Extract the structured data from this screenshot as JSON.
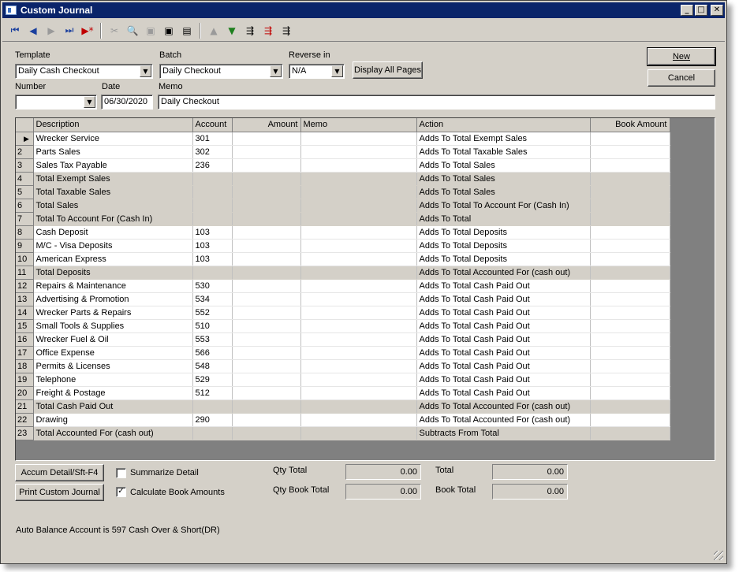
{
  "window": {
    "title": "Custom Journal",
    "min": "_",
    "max": "□",
    "close": "✕"
  },
  "toolbar": {
    "first": "⏮",
    "prev": "◀",
    "next": "▶",
    "last": "⏭",
    "new": "▶*",
    "cut": "✂",
    "find": "🔍",
    "save": "▣",
    "savenew": "▣",
    "props": "▤",
    "up": "▲",
    "down": "▼",
    "ins1": "⇶",
    "ins2": "⇶",
    "ins3": "⇶"
  },
  "form": {
    "template_label": "Template",
    "template_value": "Daily Cash Checkout",
    "batch_label": "Batch",
    "batch_value": "Daily Checkout",
    "reverse_label": "Reverse in",
    "reverse_value": "N/A",
    "display_all": "Display All Pages",
    "number_label": "Number",
    "number_value": "",
    "date_label": "Date",
    "date_value": "06/30/2020",
    "memo_label": "Memo",
    "memo_value": "Daily Checkout",
    "new_btn": "New",
    "cancel_btn": "Cancel"
  },
  "grid": {
    "headers": [
      "Description",
      "Account",
      "Amount",
      "Memo",
      "Action",
      "Book Amount"
    ],
    "rows": [
      {
        "n": "",
        "desc": "Wrecker Service",
        "acct": "301",
        "action": "Adds To Total Exempt Sales",
        "total": false
      },
      {
        "n": "2",
        "desc": "Parts Sales",
        "acct": "302",
        "action": "Adds To Total Taxable Sales",
        "total": false
      },
      {
        "n": "3",
        "desc": "Sales Tax Payable",
        "acct": "236",
        "action": "Adds To Total Sales",
        "total": false
      },
      {
        "n": "4",
        "desc": "Total Exempt Sales",
        "acct": "",
        "action": "Adds To Total Sales",
        "total": true
      },
      {
        "n": "5",
        "desc": "Total Taxable Sales",
        "acct": "",
        "action": "Adds To Total Sales",
        "total": true
      },
      {
        "n": "6",
        "desc": "Total Sales",
        "acct": "",
        "action": "Adds To Total To Account For (Cash In)",
        "total": true
      },
      {
        "n": "7",
        "desc": "Total To Account For (Cash In)",
        "acct": "",
        "action": "Adds To Total",
        "total": true
      },
      {
        "n": "8",
        "desc": "Cash Deposit",
        "acct": "103",
        "action": "Adds To Total Deposits",
        "total": false
      },
      {
        "n": "9",
        "desc": "M/C - Visa Deposits",
        "acct": "103",
        "action": "Adds To Total Deposits",
        "total": false
      },
      {
        "n": "10",
        "desc": "American Express",
        "acct": "103",
        "action": "Adds To Total Deposits",
        "total": false
      },
      {
        "n": "11",
        "desc": "Total Deposits",
        "acct": "",
        "action": "Adds To Total Accounted For (cash out)",
        "total": true
      },
      {
        "n": "12",
        "desc": "Repairs & Maintenance",
        "acct": "530",
        "action": "Adds To Total Cash Paid Out",
        "total": false
      },
      {
        "n": "13",
        "desc": "Advertising & Promotion",
        "acct": "534",
        "action": "Adds To Total Cash Paid Out",
        "total": false
      },
      {
        "n": "14",
        "desc": "Wrecker Parts & Repairs",
        "acct": "552",
        "action": "Adds To Total Cash Paid Out",
        "total": false
      },
      {
        "n": "15",
        "desc": "Small Tools & Supplies",
        "acct": "510",
        "action": "Adds To Total Cash Paid Out",
        "total": false
      },
      {
        "n": "16",
        "desc": "Wrecker Fuel & Oil",
        "acct": "553",
        "action": "Adds To Total Cash Paid Out",
        "total": false
      },
      {
        "n": "17",
        "desc": "Office Expense",
        "acct": "566",
        "action": "Adds To Total Cash Paid Out",
        "total": false
      },
      {
        "n": "18",
        "desc": "Permits & Licenses",
        "acct": "548",
        "action": "Adds To Total Cash Paid Out",
        "total": false
      },
      {
        "n": "19",
        "desc": "Telephone",
        "acct": "529",
        "action": "Adds To Total Cash Paid Out",
        "total": false
      },
      {
        "n": "20",
        "desc": "Freight & Postage",
        "acct": "512",
        "action": "Adds To Total Cash Paid Out",
        "total": false
      },
      {
        "n": "21",
        "desc": "Total Cash Paid Out",
        "acct": "",
        "action": "Adds To Total Accounted For (cash out)",
        "total": true
      },
      {
        "n": "22",
        "desc": "Drawing",
        "acct": "290",
        "action": "Adds To Total Accounted For (cash out)",
        "total": false
      },
      {
        "n": "23",
        "desc": "Total Accounted For (cash out)",
        "acct": "",
        "action": "Subtracts From Total",
        "total": true
      }
    ]
  },
  "bottom": {
    "accum_btn": "Accum Detail/Sft-F4",
    "print_btn": "Print Custom Journal",
    "summarize_label": "Summarize Detail",
    "summarize_checked": false,
    "calc_label": "Calculate Book Amounts",
    "calc_checked": true,
    "qty_total_label": "Qty Total",
    "qty_total_value": "0.00",
    "qty_book_total_label": "Qty Book Total",
    "qty_book_total_value": "0.00",
    "total_label": "Total",
    "total_value": "0.00",
    "book_total_label": "Book Total",
    "book_total_value": "0.00",
    "status": "Auto Balance Account is 597 Cash Over & Short(DR)",
    "check_mark": "✓"
  }
}
